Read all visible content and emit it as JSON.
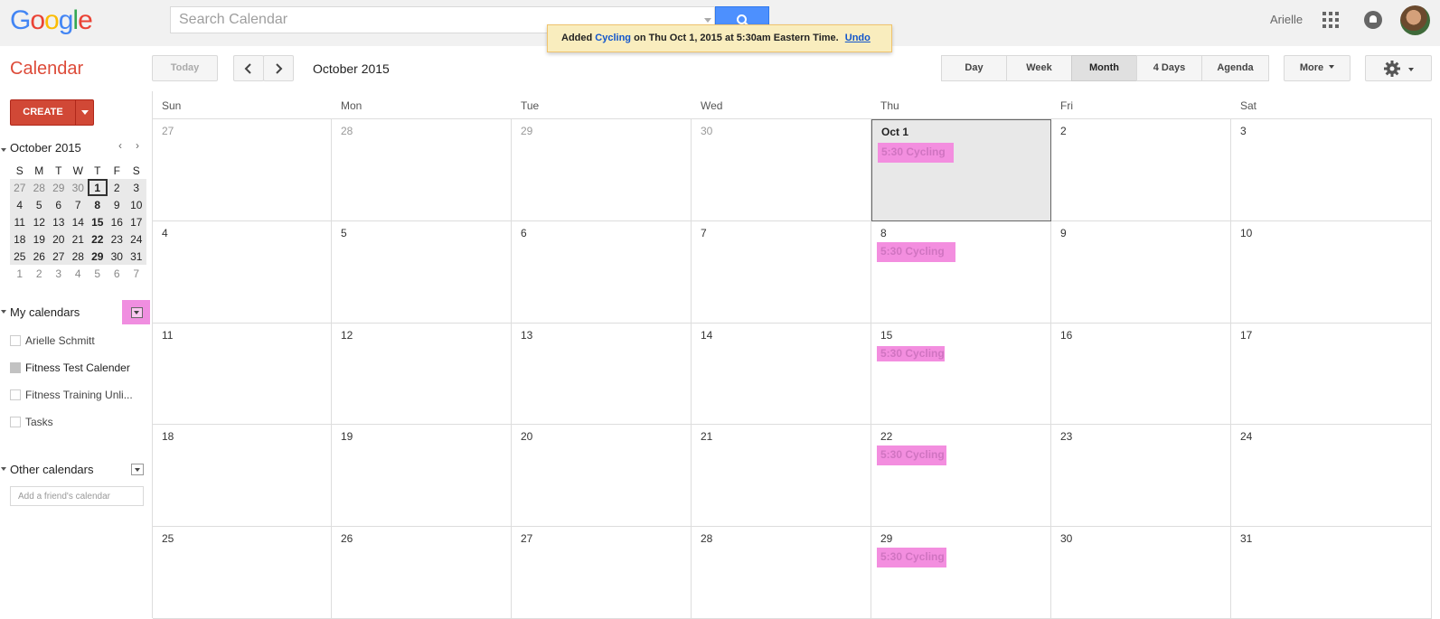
{
  "header": {
    "logo": "Google",
    "search_placeholder": "Search Calendar",
    "user_name": "Arielle"
  },
  "toast": {
    "prefix": "Added",
    "event": "Cycling",
    "suffix": "on Thu Oct 1, 2015 at 5:30am Eastern Time.",
    "undo": "Undo"
  },
  "toolbar": {
    "app_title": "Calendar",
    "today": "Today",
    "period": "October 2015",
    "views": [
      "Day",
      "Week",
      "Month",
      "4 Days",
      "Agenda"
    ],
    "active_view": "Month",
    "more": "More"
  },
  "sidebar": {
    "create": "CREATE",
    "mini_calendar": {
      "title": "October 2015",
      "weekdays": [
        "S",
        "M",
        "T",
        "W",
        "T",
        "F",
        "S"
      ],
      "weeks": [
        [
          "27",
          "28",
          "29",
          "30",
          "1",
          "2",
          "3"
        ],
        [
          "4",
          "5",
          "6",
          "7",
          "8",
          "9",
          "10"
        ],
        [
          "11",
          "12",
          "13",
          "14",
          "15",
          "16",
          "17"
        ],
        [
          "18",
          "19",
          "20",
          "21",
          "22",
          "23",
          "24"
        ],
        [
          "25",
          "26",
          "27",
          "28",
          "29",
          "30",
          "31"
        ],
        [
          "1",
          "2",
          "3",
          "4",
          "5",
          "6",
          "7"
        ]
      ]
    },
    "my_calendars_label": "My calendars",
    "my_calendars": [
      {
        "name": "Arielle Schmitt",
        "checked": false
      },
      {
        "name": "Fitness Test Calender",
        "checked": true
      },
      {
        "name": "Fitness Training Unli...",
        "checked": false
      },
      {
        "name": "Tasks",
        "checked": false
      }
    ],
    "other_calendars_label": "Other calendars",
    "friend_placeholder": "Add a friend's calendar"
  },
  "month": {
    "weekdays": [
      "Sun",
      "Mon",
      "Tue",
      "Wed",
      "Thu",
      "Fri",
      "Sat"
    ],
    "weeks": [
      [
        "27",
        "28",
        "29",
        "30",
        "Oct 1",
        "2",
        "3"
      ],
      [
        "4",
        "5",
        "6",
        "7",
        "8",
        "9",
        "10"
      ],
      [
        "11",
        "12",
        "13",
        "14",
        "15",
        "16",
        "17"
      ],
      [
        "18",
        "19",
        "20",
        "21",
        "22",
        "23",
        "24"
      ],
      [
        "25",
        "26",
        "27",
        "28",
        "29",
        "30",
        "31"
      ]
    ],
    "event_label": "5:30 Cycling",
    "event_color": "#f38edf"
  }
}
